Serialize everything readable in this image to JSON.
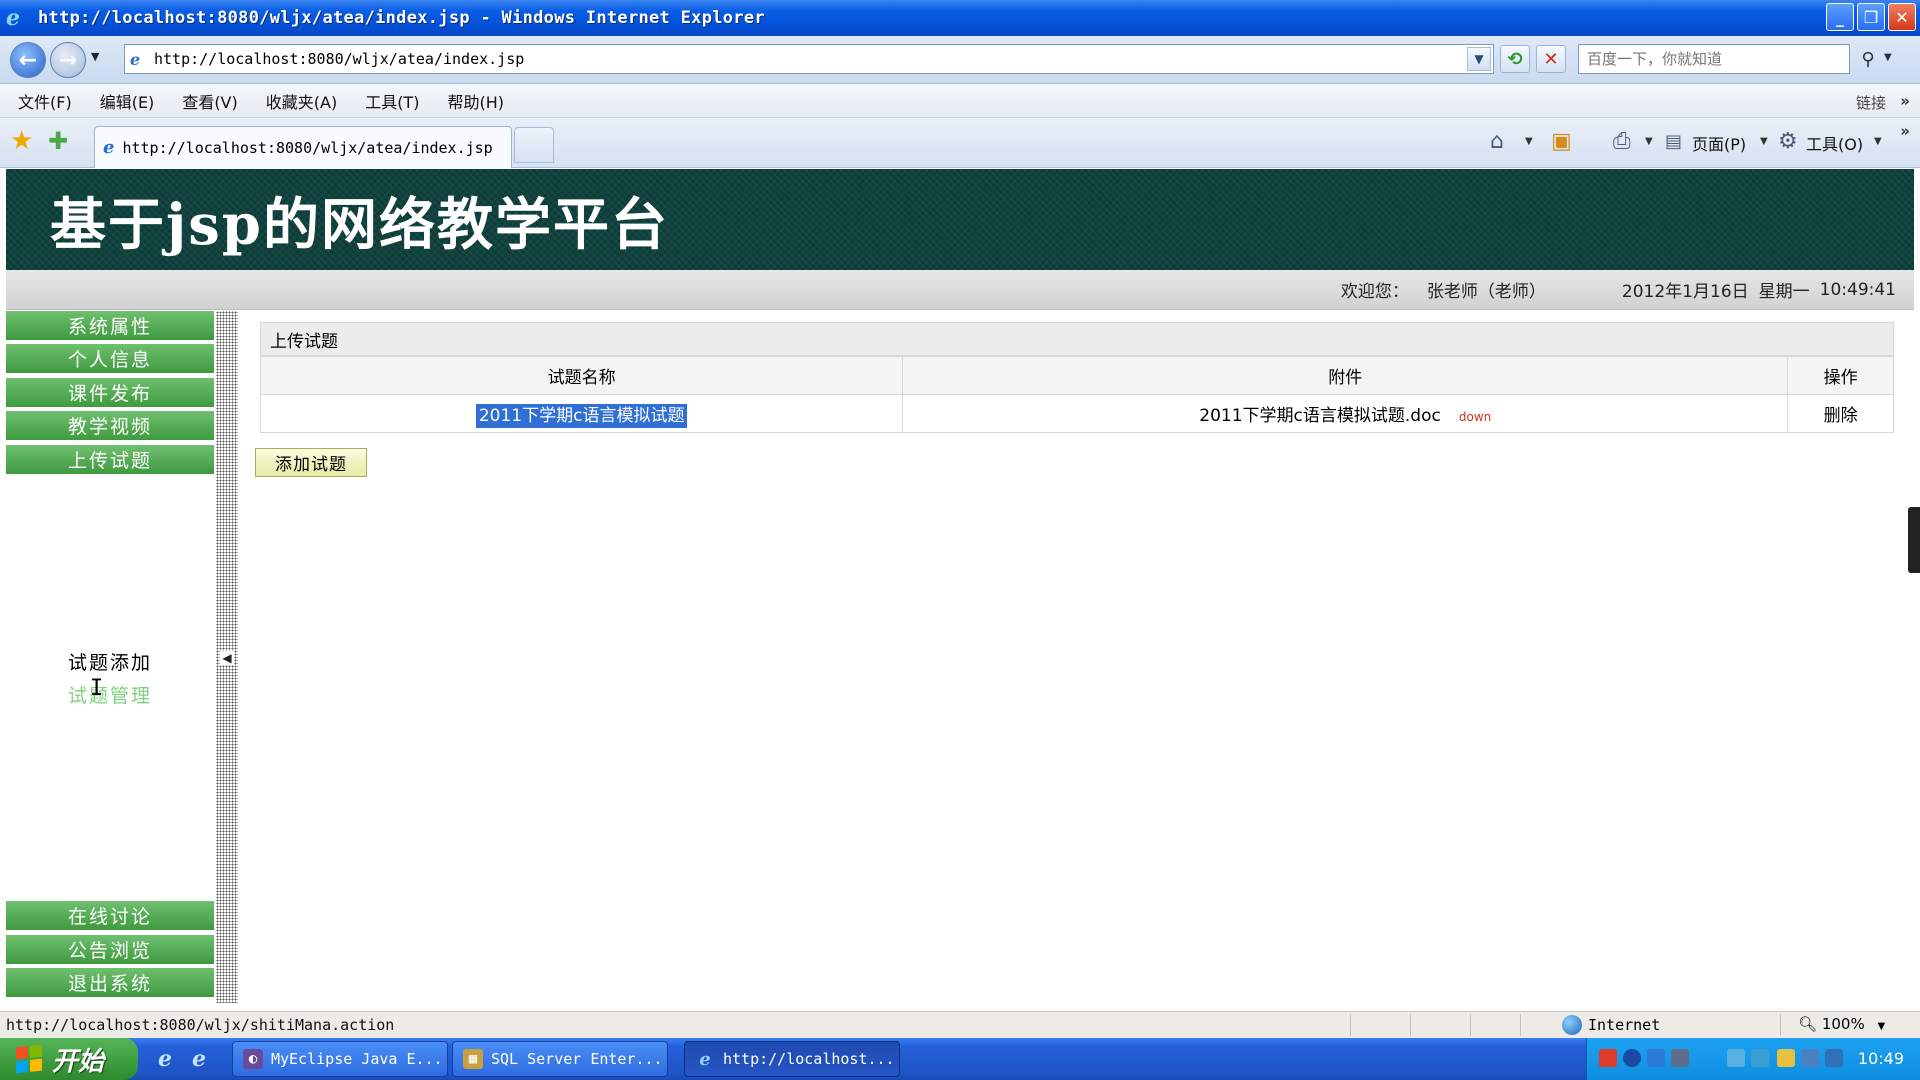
{
  "window": {
    "title": "http://localhost:8080/wljx/atea/index.jsp - Windows Internet Explorer",
    "buttons": [
      "_",
      "❐",
      "✕"
    ]
  },
  "addressbar": {
    "url": "http://localhost:8080/wljx/atea/index.jsp",
    "search_placeholder": "百度一下，你就知道"
  },
  "menubar": {
    "items": [
      "文件(F)",
      "编辑(E)",
      "查看(V)",
      "收藏夹(A)",
      "工具(T)",
      "帮助(H)"
    ],
    "links_label": "链接"
  },
  "tabbar": {
    "tab_title": "http://localhost:8080/wljx/atea/index.jsp",
    "page_label": "页面(P)",
    "tools_label": "工具(O)"
  },
  "site": {
    "title": "基于jsp的网络教学平台",
    "welcome_label": "欢迎您：",
    "user": "张老师（老师）",
    "date": "2012年1月16日",
    "weekday": "星期一",
    "time": "10:49:41"
  },
  "sidebar": {
    "top_items": [
      "系统属性",
      "个人信息",
      "课件发布",
      "教学视频",
      "上传试题"
    ],
    "sub_items": [
      "试题添加",
      "试题管理"
    ],
    "bottom_items": [
      "在线讨论",
      "公告浏览",
      "退出系统"
    ]
  },
  "content": {
    "panel_title": "上传试题",
    "columns": [
      "试题名称",
      "附件",
      "操作"
    ],
    "rows": [
      {
        "name": "2011下学期c语言模拟试题",
        "attachment": "2011下学期c语言模拟试题.doc",
        "download_label": "down",
        "action": "删除"
      }
    ],
    "add_button": "添加试题"
  },
  "statusbar": {
    "url": "http://localhost:8080/wljx/shitiMana.action",
    "zone": "Internet",
    "zoom": "100%"
  },
  "taskbar": {
    "start_label": "开始",
    "tasks": [
      "MyEclipse Java E...",
      "SQL Server Enter...",
      "http://localhost..."
    ],
    "clock": "10:49"
  },
  "colors": {
    "banner": "#0f423e",
    "sidebar_button": "#4fa84f",
    "selection": "#2f6fd6",
    "taskbar": "#2560d8"
  }
}
